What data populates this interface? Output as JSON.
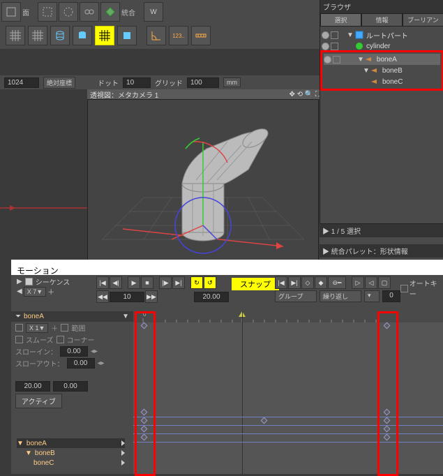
{
  "toolbar": {
    "face_label": "面",
    "integrate_label": "統合"
  },
  "params": {
    "size": "1024",
    "coord_label": "絶対座標",
    "dot_label": "ドット",
    "dot_val": "10",
    "grid_label": "グリッド",
    "grid_val": "100",
    "unit": "mm"
  },
  "viewport": {
    "title": "透視図：メタカメラ 1"
  },
  "browser": {
    "title": "ブラウザ",
    "tabs": [
      "選択",
      "情報",
      "ブーリアン"
    ],
    "root": "ルートパート",
    "items": [
      "cylinder",
      "boneA",
      "boneB",
      "boneC"
    ]
  },
  "sel": {
    "info": "1 / 5 選択",
    "palette": "統合パレット：形状情報"
  },
  "motion": {
    "title": "モーション",
    "seq_label": "シーケンス",
    "x7": "X 7▼",
    "frame": "10",
    "time": "20.00",
    "snap": "スナップ",
    "autokey": "オートキー",
    "group_label": "グループ",
    "repeat_label": "繰り返し",
    "bone_main": "boneA",
    "x1": "X 1▼",
    "range_label": "範囲",
    "smooth": "スムーズ",
    "corner": "コーナー",
    "slowin": "スローイン：",
    "slowout": "スローアウト：",
    "zero": "0.00",
    "t1": "20.00",
    "t2": "0.00",
    "active": "アクティブ",
    "bones": [
      "boneA",
      "boneB",
      "boneC"
    ],
    "ruler_start": "0"
  }
}
